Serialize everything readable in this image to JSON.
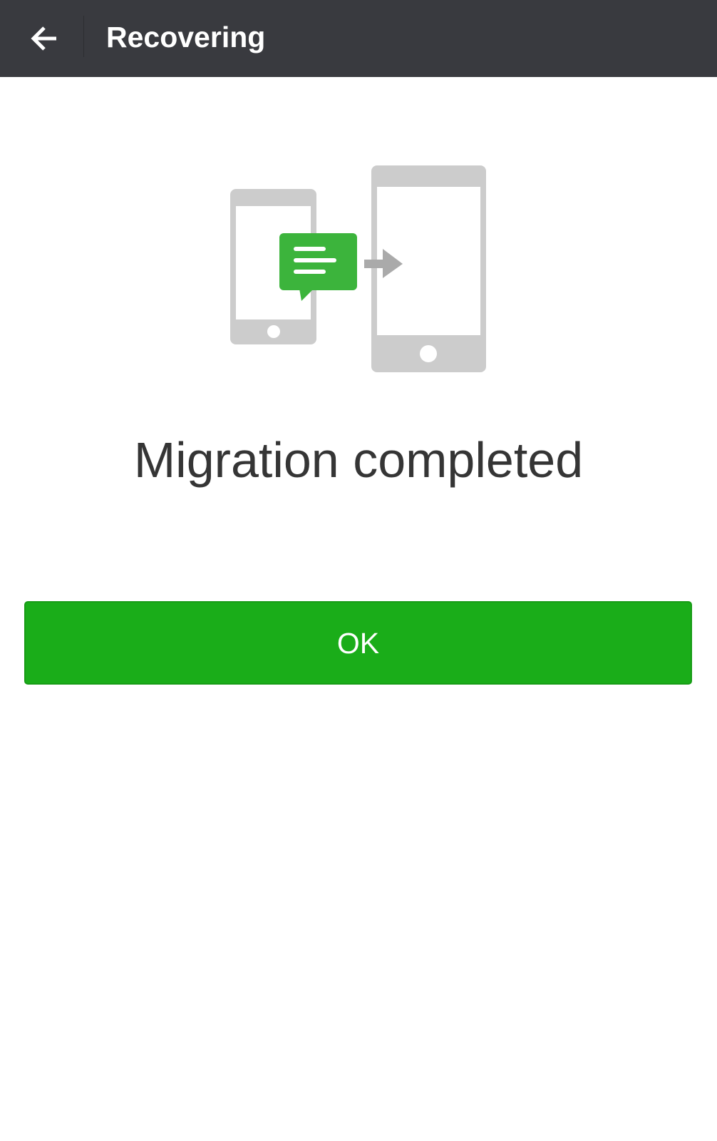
{
  "header": {
    "title": "Recovering",
    "back_icon": "arrow-left-icon"
  },
  "illustration": {
    "icons": [
      "old-phone-icon",
      "message-bubble-icon",
      "arrow-right-icon",
      "new-phone-icon"
    ]
  },
  "main": {
    "status_title": "Migration completed"
  },
  "actions": {
    "ok_label": "OK"
  },
  "colors": {
    "topbar_bg": "#393a3f",
    "accent_green": "#1aad19",
    "bubble_green": "#3cb43c",
    "phone_gray": "#cccccc",
    "text_dark": "#353535"
  }
}
